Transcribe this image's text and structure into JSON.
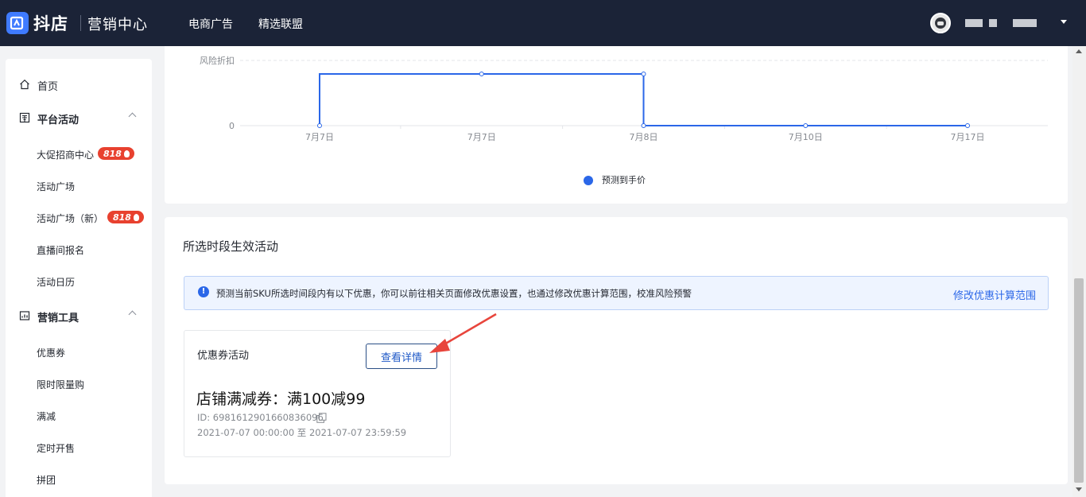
{
  "header": {
    "brand": "抖店",
    "subtitle": "营销中心",
    "nav": [
      "电商广告",
      "精选联盟"
    ]
  },
  "sidebar": {
    "home": "首页",
    "groups": [
      {
        "label": "平台活动",
        "items": [
          {
            "label": "大促招商中心",
            "badge": "818"
          },
          {
            "label": "活动广场"
          },
          {
            "label": "活动广场（新）",
            "badge": "818"
          },
          {
            "label": "直播间报名"
          },
          {
            "label": "活动日历"
          }
        ]
      },
      {
        "label": "营销工具",
        "items": [
          {
            "label": "优惠券"
          },
          {
            "label": "限时限量购"
          },
          {
            "label": "满减"
          },
          {
            "label": "定时开售"
          },
          {
            "label": "拼团"
          }
        ]
      }
    ]
  },
  "chart_data": {
    "type": "line",
    "ylabel": "风险折扣",
    "x": [
      "7月7日",
      "7月7日",
      "7月8日",
      "7月10日",
      "7月17日"
    ],
    "y_ticks": [
      "0"
    ],
    "series": [
      {
        "name": "预测到手价",
        "step": true,
        "values": [
          0,
          1,
          1,
          0,
          0
        ],
        "color": "#2b67e8"
      }
    ],
    "legend": "bottom"
  },
  "activities": {
    "title": "所选时段生效活动",
    "notice": "预测当前SKU所选时间段内有以下优惠，你可以前往相关页面修改优惠设置，也通过修改优惠计算范围，校准风险预警",
    "notice_link": "修改优惠计算范围",
    "coupon": {
      "type_label": "优惠券活动",
      "detail_button": "查看详情",
      "name": "店铺满减券：满100减99",
      "id_text": "ID: 6981612901660836096",
      "time_text": "2021-07-07 00:00:00 至 2021-07-07 23:59:59"
    }
  }
}
